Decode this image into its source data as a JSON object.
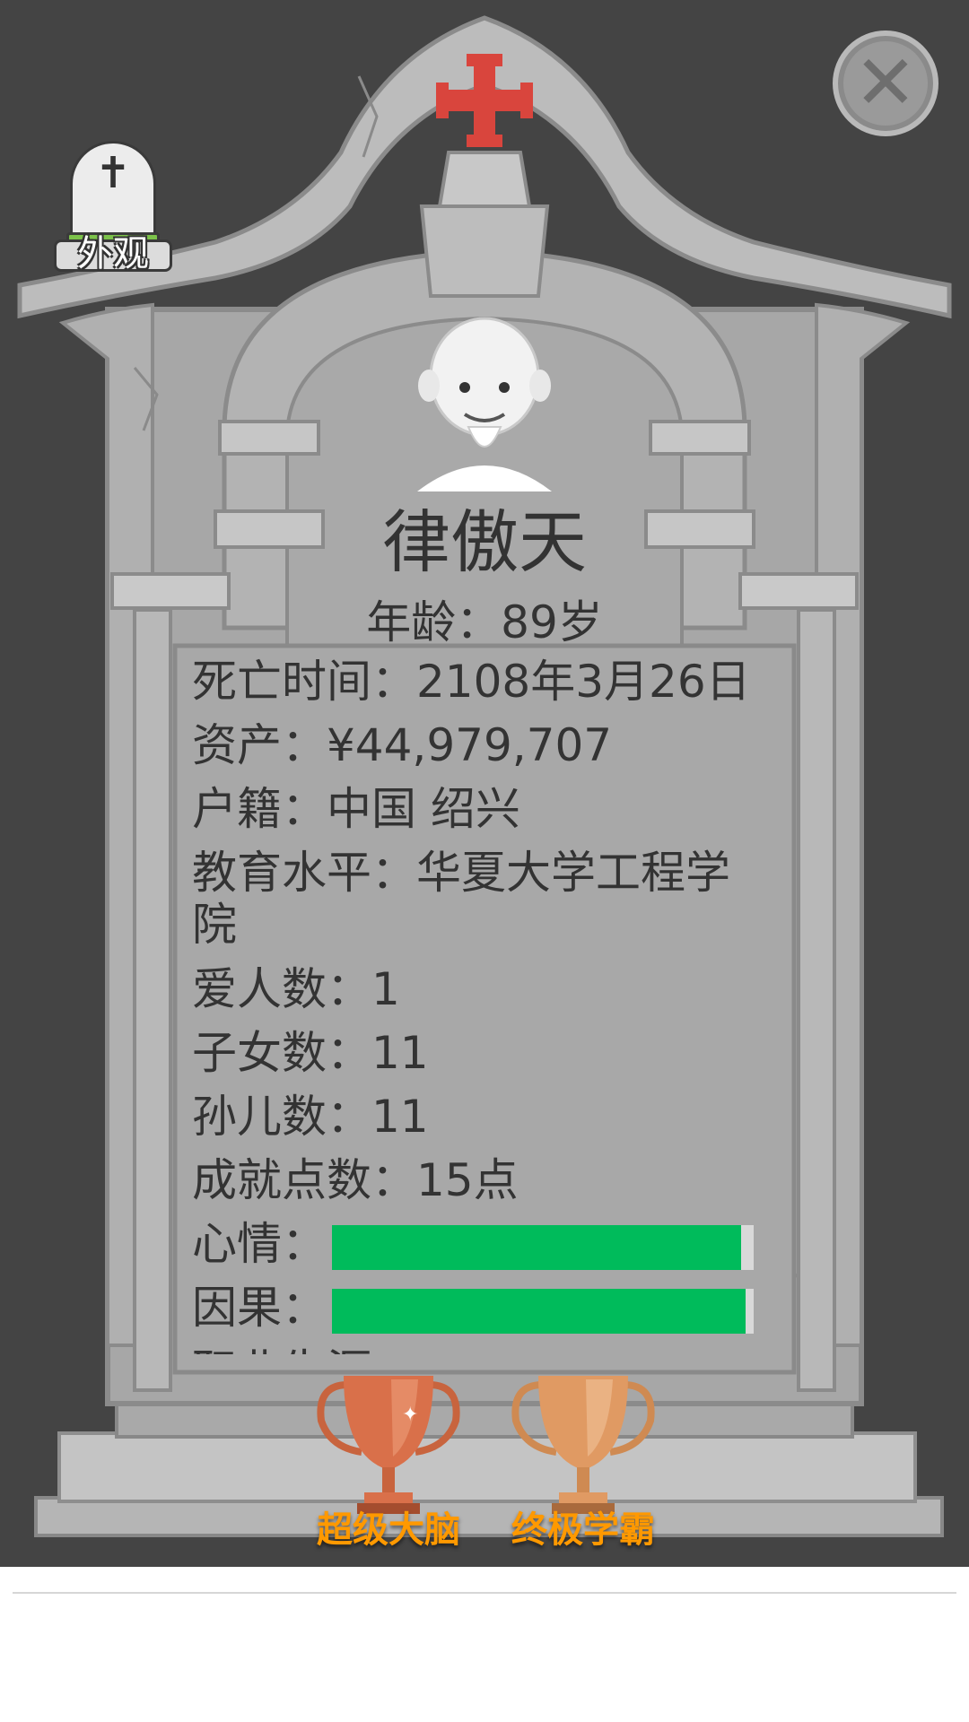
{
  "skin_button": {
    "label": "外观",
    "icon": "cross-tombstone-icon"
  },
  "close_button": {
    "icon": "close-icon",
    "glyph": "✕"
  },
  "cross": {
    "color": "#d9453d"
  },
  "profile": {
    "name": "律傲天",
    "age_line": "年龄：89岁",
    "rows": [
      "死亡时间：2108年3月26日",
      "资产：¥44,979,707",
      "户籍：中国 绍兴",
      "教育水平：华夏大学工程学院",
      "爱人数：1",
      "子女数：11",
      "孙儿数：11",
      "成就点数：15点"
    ],
    "mood": {
      "label": "心情：",
      "value": 0.97,
      "color": "#00bb5b"
    },
    "karma": {
      "label": "因果：",
      "value": 0.98,
      "color": "#00bb5b"
    },
    "cut_off_row": "职业生涯"
  },
  "achievements": [
    {
      "label": "超级大脑",
      "icon": "trophy-icon"
    },
    {
      "label": "终极学霸",
      "icon": "trophy-icon"
    }
  ]
}
